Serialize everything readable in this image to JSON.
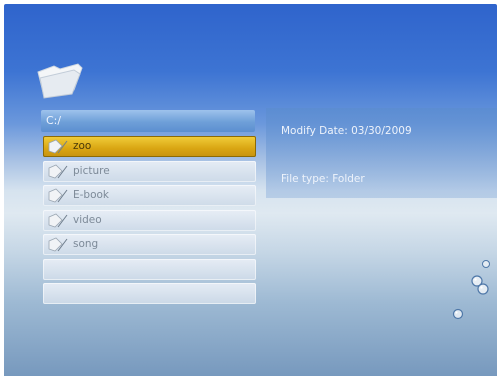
{
  "browser": {
    "path": "C:/",
    "items": [
      {
        "name": "zoo",
        "selected": true
      },
      {
        "name": "picture",
        "selected": false
      },
      {
        "name": "E-book",
        "selected": false
      },
      {
        "name": "video",
        "selected": false
      },
      {
        "name": "song",
        "selected": false
      },
      {
        "name": "",
        "selected": false
      },
      {
        "name": "",
        "selected": false
      }
    ]
  },
  "details": {
    "modify_date": "Modify Date: 03/30/2009",
    "file_type": "File type: Folder"
  },
  "icons": {
    "logo": "open-folder-icon",
    "item": "document-icon",
    "decoration": "water-bubble-icon"
  },
  "colors": {
    "selection": "#d9a512",
    "path_bar": "#6e9fd8",
    "background_top": "#2f64cc"
  }
}
